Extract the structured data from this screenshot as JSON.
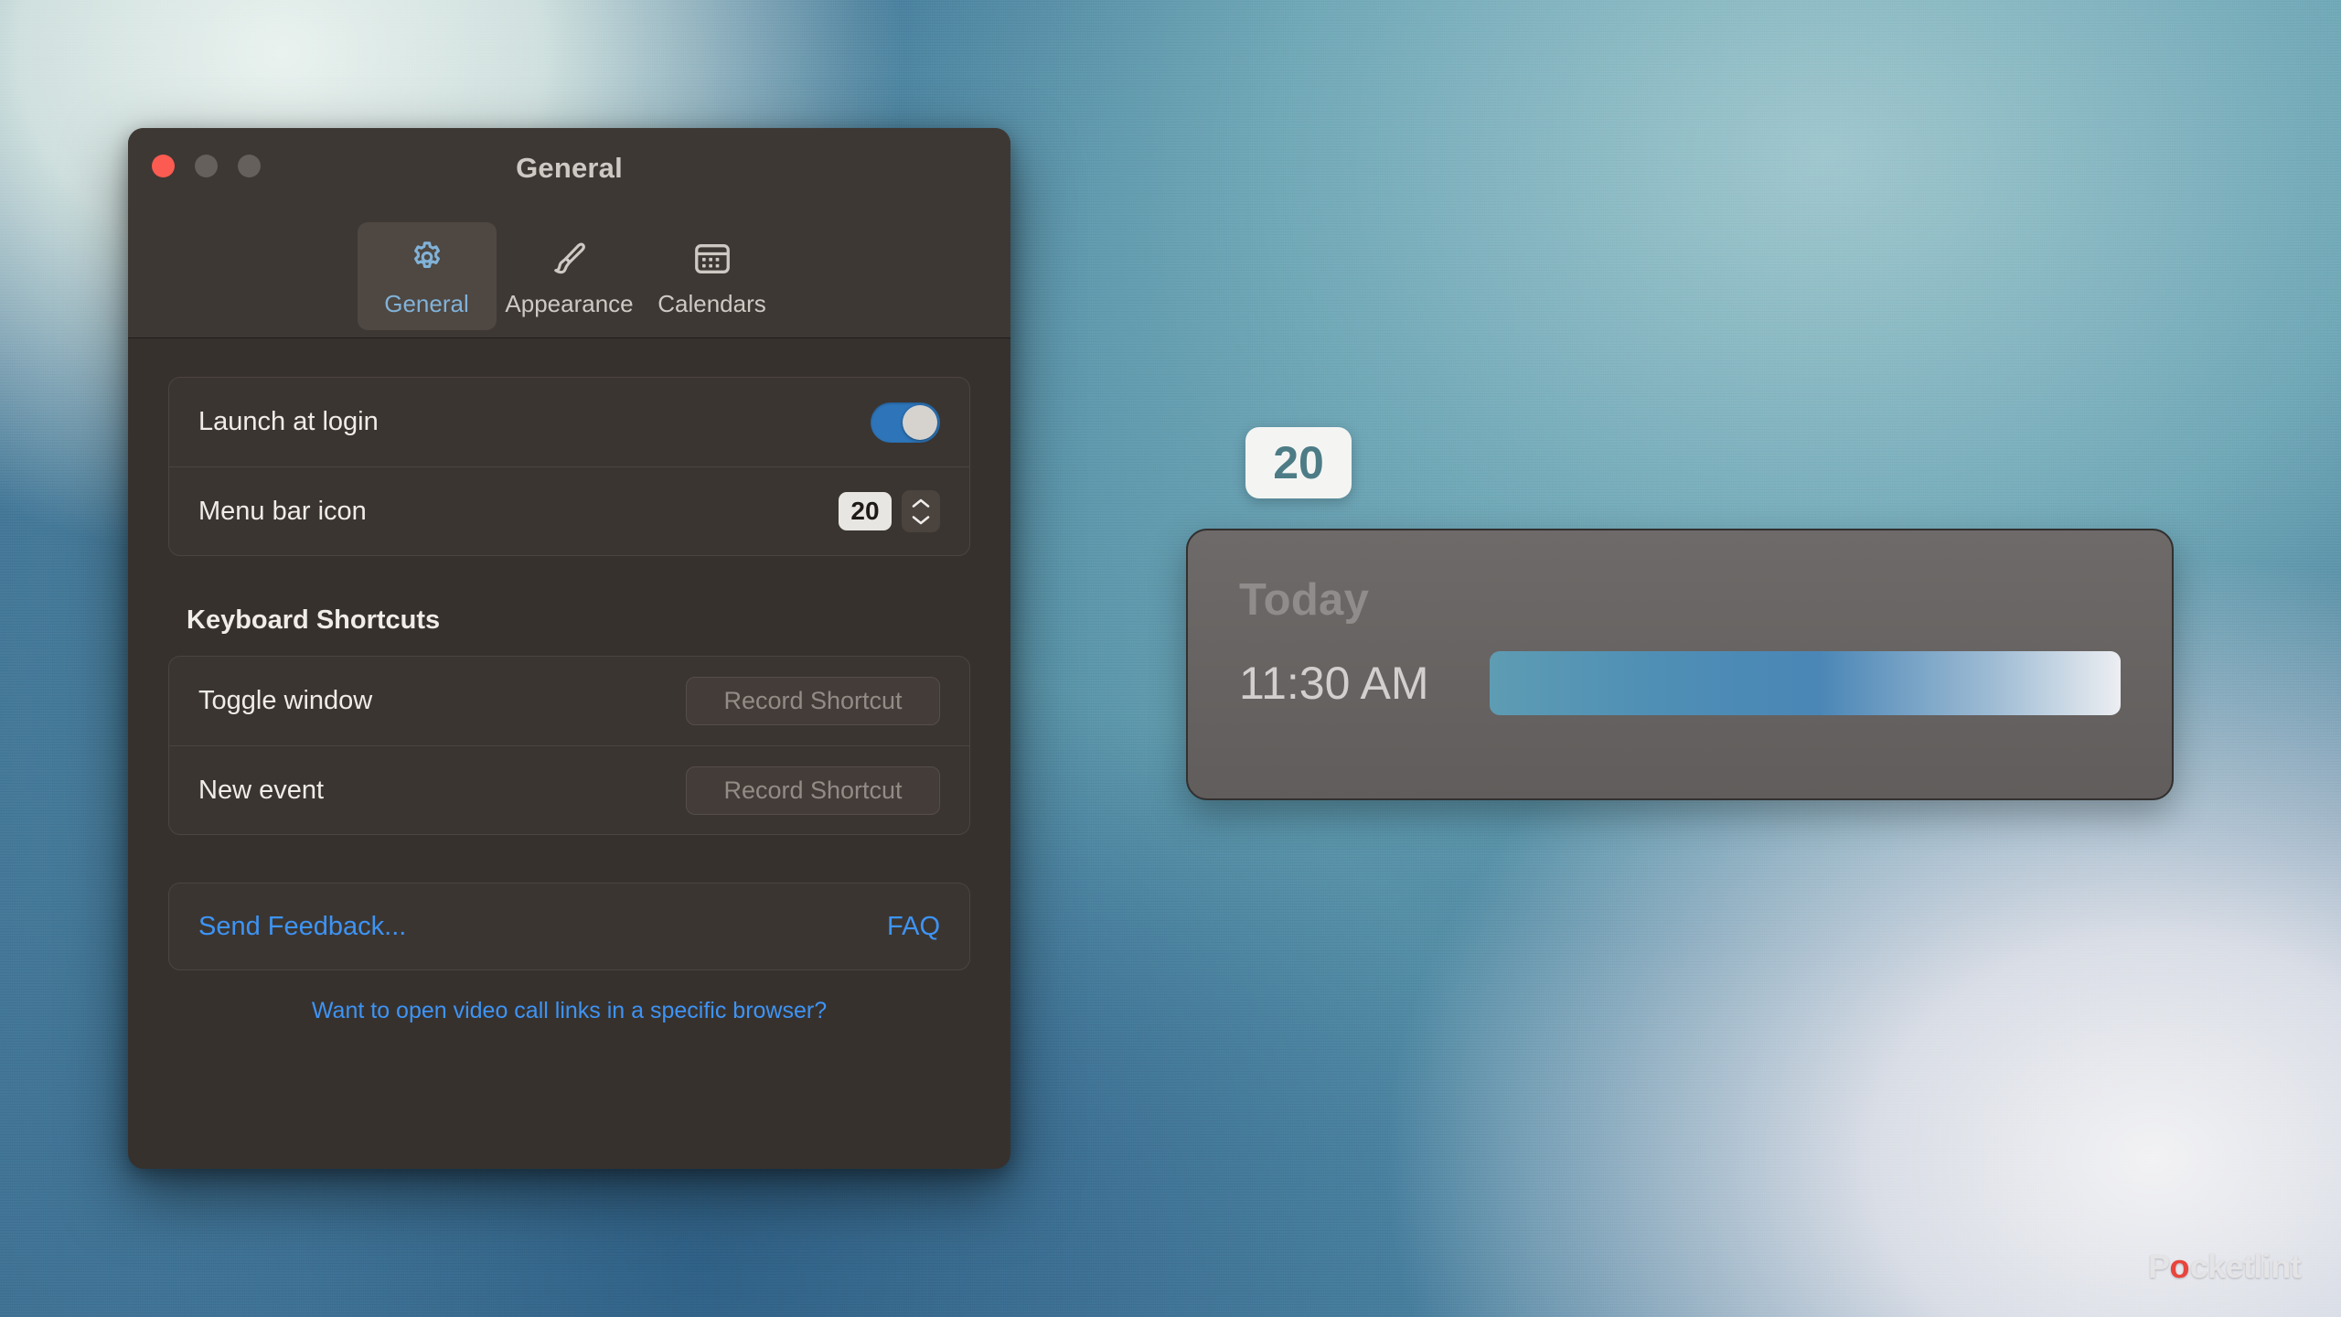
{
  "window": {
    "title": "General",
    "traffic_lights": [
      "close",
      "minimize",
      "zoom"
    ],
    "tabs": [
      {
        "label": "General",
        "icon": "gear-icon",
        "active": true
      },
      {
        "label": "Appearance",
        "icon": "paintbrush-icon",
        "active": false
      },
      {
        "label": "Calendars",
        "icon": "calendar-icon",
        "active": false
      }
    ]
  },
  "settings": {
    "launch_at_login": {
      "label": "Launch at login",
      "value": "on"
    },
    "menu_bar_icon": {
      "label": "Menu bar icon",
      "value": "20"
    }
  },
  "shortcuts": {
    "heading": "Keyboard Shortcuts",
    "items": [
      {
        "label": "Toggle window",
        "button": "Record Shortcut"
      },
      {
        "label": "New event",
        "button": "Record Shortcut"
      }
    ]
  },
  "footer": {
    "send_feedback": "Send Feedback...",
    "faq": "FAQ",
    "browser_note": "Want to open video call links in a specific browser?"
  },
  "menu_bar_badge": {
    "value": "20"
  },
  "widget": {
    "title": "Today",
    "time": "11:30 AM",
    "event_bar": "event-gradient-bar"
  },
  "watermark": {
    "pre": "P",
    "accent": "o",
    "post": "cketlint"
  },
  "colors": {
    "accent_blue": "#3d94f5",
    "toggle_on": "#2d74b8",
    "tab_active_text": "#81b2d8",
    "window_bg": "#37312e",
    "titlebar_bg": "#3e3834",
    "close_red": "#fc5b51"
  }
}
